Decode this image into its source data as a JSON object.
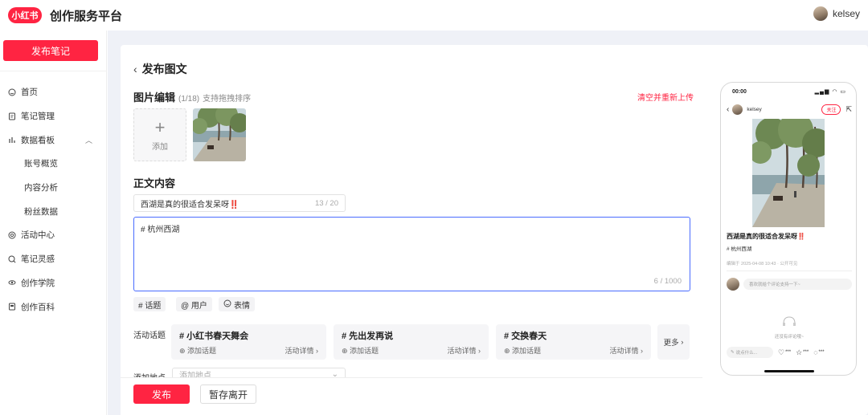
{
  "app": {
    "logo_text": "小红书",
    "title": "创作服务平台",
    "user_name": "kelsey"
  },
  "sidebar": {
    "publish_label": "发布笔记",
    "items": [
      {
        "label": "首页",
        "icon": "home-icon"
      },
      {
        "label": "笔记管理",
        "icon": "note-icon"
      },
      {
        "label": "数据看板",
        "icon": "chart-icon",
        "expanded": true
      },
      {
        "label": "账号概览",
        "sub": true
      },
      {
        "label": "内容分析",
        "sub": true
      },
      {
        "label": "粉丝数据",
        "sub": true
      },
      {
        "label": "活动中心",
        "icon": "activity-icon"
      },
      {
        "label": "笔记灵感",
        "icon": "inspiration-icon"
      },
      {
        "label": "创作学院",
        "icon": "academy-icon"
      },
      {
        "label": "创作百科",
        "icon": "wiki-icon"
      }
    ]
  },
  "editor": {
    "page_title": "发布图文",
    "images_title": "图片编辑",
    "images_count": "(1/18)",
    "images_hint": "支持拖拽排序",
    "clear_label": "清空并重新上传",
    "add_label": "添加",
    "body_title": "正文内容",
    "title_value": "西湖是真的很适合发呆呀",
    "title_emoji": "‼️",
    "title_count": "13 / 20",
    "body_value": "# 杭州西湖",
    "body_count": "6 / 1000",
    "tools": [
      "# 话题",
      "@ 用户",
      "表情"
    ],
    "topics_label": "活动话题",
    "topics": [
      {
        "name": "# 小红书春天舞会",
        "add": "添加话题",
        "detail": "活动详情"
      },
      {
        "name": "# 先出发再说",
        "add": "添加话题",
        "detail": "活动详情"
      },
      {
        "name": "# 交换春天",
        "add": "添加话题",
        "detail": "活动详情"
      }
    ],
    "more_label": "更多",
    "location_label": "添加地点",
    "location_placeholder": "添加地点",
    "publish_label": "发布",
    "save_label": "暂存离开"
  },
  "preview": {
    "time": "00:00",
    "user": "kelsey",
    "follow": "关注",
    "title": "西湖是真的很适合发呆呀",
    "title_emoji": "‼️",
    "tag": "# 杭州西湖",
    "meta": "编辑于 2025-04-08 10:43 · 公开可见",
    "comment_placeholder": "喜欢就给个评论支持一下~",
    "empty_text": "还没有评论哦~",
    "say_placeholder": "说点什么...",
    "like": "***",
    "collect": "***",
    "comment": "***"
  },
  "colors": {
    "brand": "#ff2442",
    "focus": "#4a6cff",
    "main_bg": "#eff1f7"
  }
}
